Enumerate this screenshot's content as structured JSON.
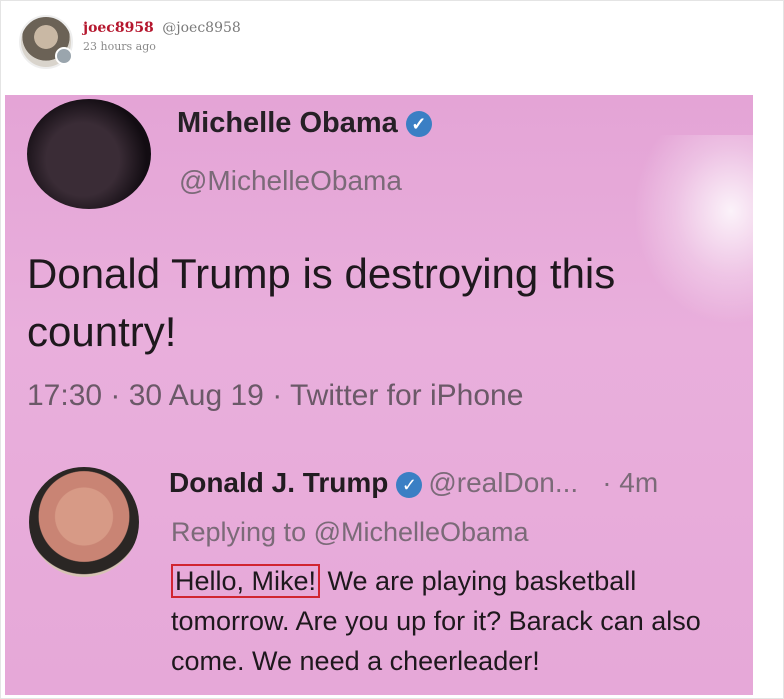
{
  "post": {
    "username": "joec8958",
    "handle": "@joec8958",
    "timestamp": "23 hours ago"
  },
  "screenshot": {
    "tweet1": {
      "name": "Michelle Obama",
      "verified_glyph": "✓",
      "handle": "@MichelleObama",
      "text_line1": "Donald Trump is destroying this",
      "text_line2": "country!",
      "meta": "17:30 · 30 Aug 19 · Twitter for iPhone"
    },
    "tweet2": {
      "name": "Donald J. Trump",
      "verified_glyph": "✓",
      "handle": "@realDon...",
      "time_ago": "· 4m",
      "replying_to": "Replying to @MichelleObama",
      "highlighted_text": "Hello, Mike!",
      "text_rest": " We are playing basketball tomorrow. Are you up for it? Barack can also come. We need a cheerleader!"
    }
  },
  "colors": {
    "username": "#b5172e",
    "photo_background": "#e6a8d8",
    "highlight_border": "#d12531",
    "verified_badge": "#3a7fc4"
  }
}
